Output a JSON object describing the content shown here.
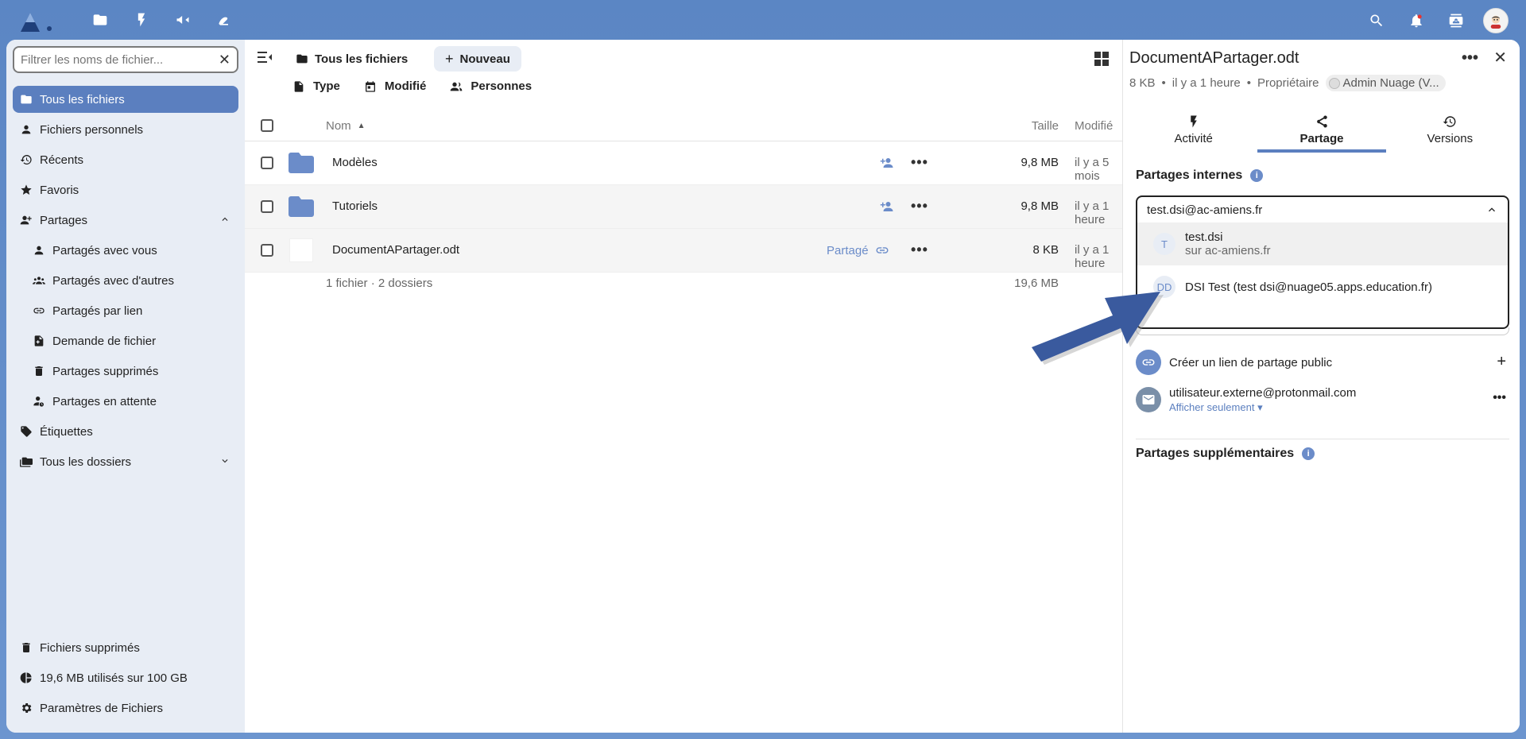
{
  "header": {
    "apps": [
      "files-icon",
      "activity-icon",
      "announcements-icon",
      "whiteboard-icon"
    ],
    "right": [
      "search-icon",
      "notifications-icon",
      "contacts-icon",
      "user-avatar"
    ]
  },
  "sidebar": {
    "filter_placeholder": "Filtrer les noms de fichier...",
    "items": [
      {
        "label": "Tous les fichiers",
        "icon": "folder-icon",
        "active": true
      },
      {
        "label": "Fichiers personnels",
        "icon": "user-icon"
      },
      {
        "label": "Récents",
        "icon": "history-icon"
      },
      {
        "label": "Favoris",
        "icon": "star-icon"
      },
      {
        "label": "Partages",
        "icon": "share-icon"
      },
      {
        "label": "Partagés avec vous",
        "icon": "user-icon"
      },
      {
        "label": "Partagés avec d'autres",
        "icon": "group-icon"
      },
      {
        "label": "Partagés par lien",
        "icon": "link-icon"
      },
      {
        "label": "Demande de fichier",
        "icon": "file-request-icon"
      },
      {
        "label": "Partages supprimés",
        "icon": "trash-icon"
      },
      {
        "label": "Partages en attente",
        "icon": "pending-icon"
      },
      {
        "label": "Étiquettes",
        "icon": "tag-icon"
      },
      {
        "label": "Tous les dossiers",
        "icon": "folders-icon"
      }
    ],
    "bottom": {
      "trash": "Fichiers supprimés",
      "quota": "19,6 MB utilisés sur 100 GB",
      "settings": "Paramètres de Fichiers"
    }
  },
  "files": {
    "breadcrumb": "Tous les fichiers",
    "new_label": "Nouveau",
    "filters": [
      "Type",
      "Modifié",
      "Personnes"
    ],
    "columns": {
      "name": "Nom",
      "size": "Taille",
      "modified": "Modifié"
    },
    "rows": [
      {
        "name": "Modèles",
        "type": "folder",
        "size": "9,8 MB",
        "modified": "il y a 5 mois"
      },
      {
        "name": "Tutoriels",
        "type": "folder",
        "size": "9,8 MB",
        "modified": "il y a 1 heure"
      },
      {
        "name": "DocumentAPartager.odt",
        "type": "file",
        "shared": "Partagé",
        "size": "8 KB",
        "modified": "il y a 1 heure"
      }
    ],
    "summary": {
      "count": "1 fichier · 2 dossiers",
      "total": "19,6 MB"
    }
  },
  "panel": {
    "title": "DocumentAPartager.odt",
    "meta": {
      "size": "8 KB",
      "time": "il y a 1 heure",
      "owner_label": "Propriétaire",
      "owner": "Admin Nuage (V..."
    },
    "tabs": [
      "Activité",
      "Partage",
      "Versions"
    ],
    "internal_title": "Partages internes",
    "search_value": "test.dsi@ac-amiens.fr",
    "options": [
      {
        "avatar": "T",
        "name": "test.dsi",
        "sub": "sur ac-amiens.fr"
      },
      {
        "avatar": "DD",
        "name": "DSI Test (test dsi@nuage05.apps.education.fr)"
      }
    ],
    "public_link": "Créer un lien de partage public",
    "external": {
      "email": "utilisateur.externe@protonmail.com",
      "permission": "Afficher seulement"
    },
    "additional_title": "Partages supplémentaires"
  },
  "colors": {
    "accent": "#5b7fbf",
    "folder": "#6b8cc9",
    "arrow": "#3a5a9e"
  }
}
